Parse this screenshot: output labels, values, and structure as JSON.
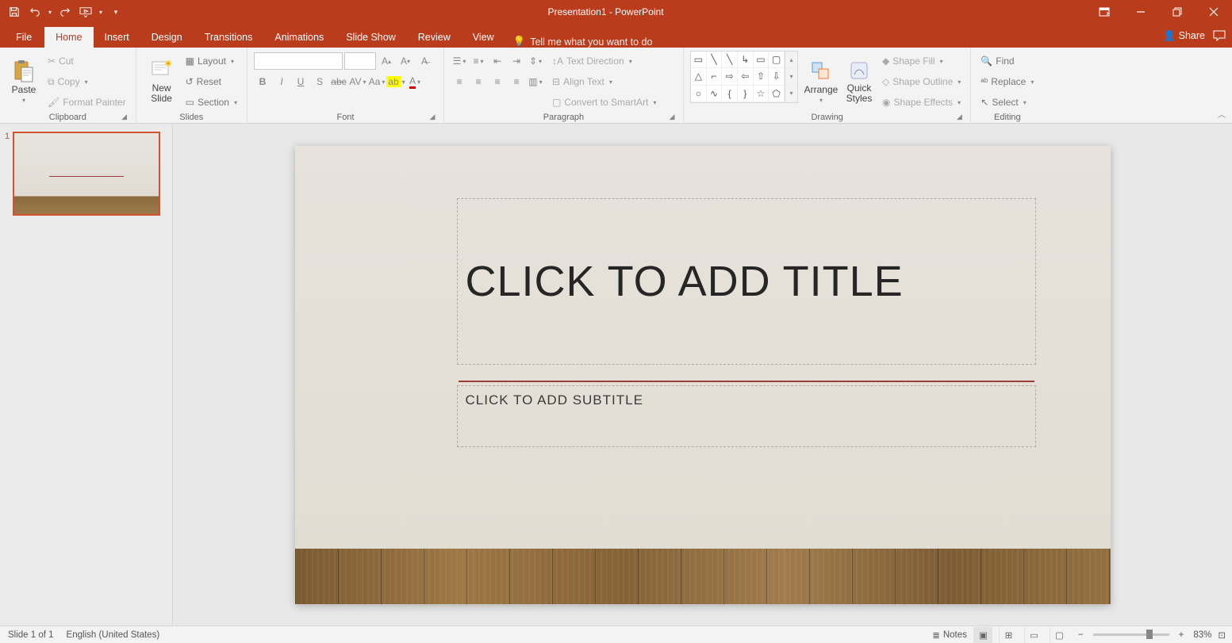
{
  "titlebar": {
    "title": "Presentation1 - PowerPoint"
  },
  "qat": {
    "save": "Save",
    "undo": "Undo",
    "redo": "Redo",
    "start": "Start From Beginning",
    "customize": "Customize Quick Access Toolbar"
  },
  "window": {
    "displayopts": "Ribbon Display Options",
    "min": "Minimize",
    "max": "Restore Down",
    "close": "Close"
  },
  "tabs": {
    "file": "File",
    "home": "Home",
    "insert": "Insert",
    "design": "Design",
    "transitions": "Transitions",
    "animations": "Animations",
    "slideshow": "Slide Show",
    "review": "Review",
    "view": "View",
    "tellme": "Tell me what you want to do",
    "share": "Share"
  },
  "ribbon": {
    "clipboard": {
      "label": "Clipboard",
      "paste": "Paste",
      "cut": "Cut",
      "copy": "Copy",
      "formatpainter": "Format Painter"
    },
    "slides": {
      "label": "Slides",
      "newslide": "New\nSlide",
      "layout": "Layout",
      "reset": "Reset",
      "section": "Section"
    },
    "font": {
      "label": "Font"
    },
    "paragraph": {
      "label": "Paragraph",
      "textdir": "Text Direction",
      "align": "Align Text",
      "smartart": "Convert to SmartArt"
    },
    "drawing": {
      "label": "Drawing",
      "arrange": "Arrange",
      "quickstyles": "Quick\nStyles",
      "shapefill": "Shape Fill",
      "shapeoutline": "Shape Outline",
      "shapeeffects": "Shape Effects"
    },
    "editing": {
      "label": "Editing",
      "find": "Find",
      "replace": "Replace",
      "select": "Select"
    }
  },
  "thumbnails": {
    "slide1_num": "1"
  },
  "slide": {
    "title_placeholder": "CLICK TO ADD TITLE",
    "subtitle_placeholder": "CLICK TO ADD SUBTITLE"
  },
  "statusbar": {
    "slideinfo": "Slide 1 of 1",
    "language": "English (United States)",
    "notes": "Notes",
    "zoom": "83%"
  }
}
